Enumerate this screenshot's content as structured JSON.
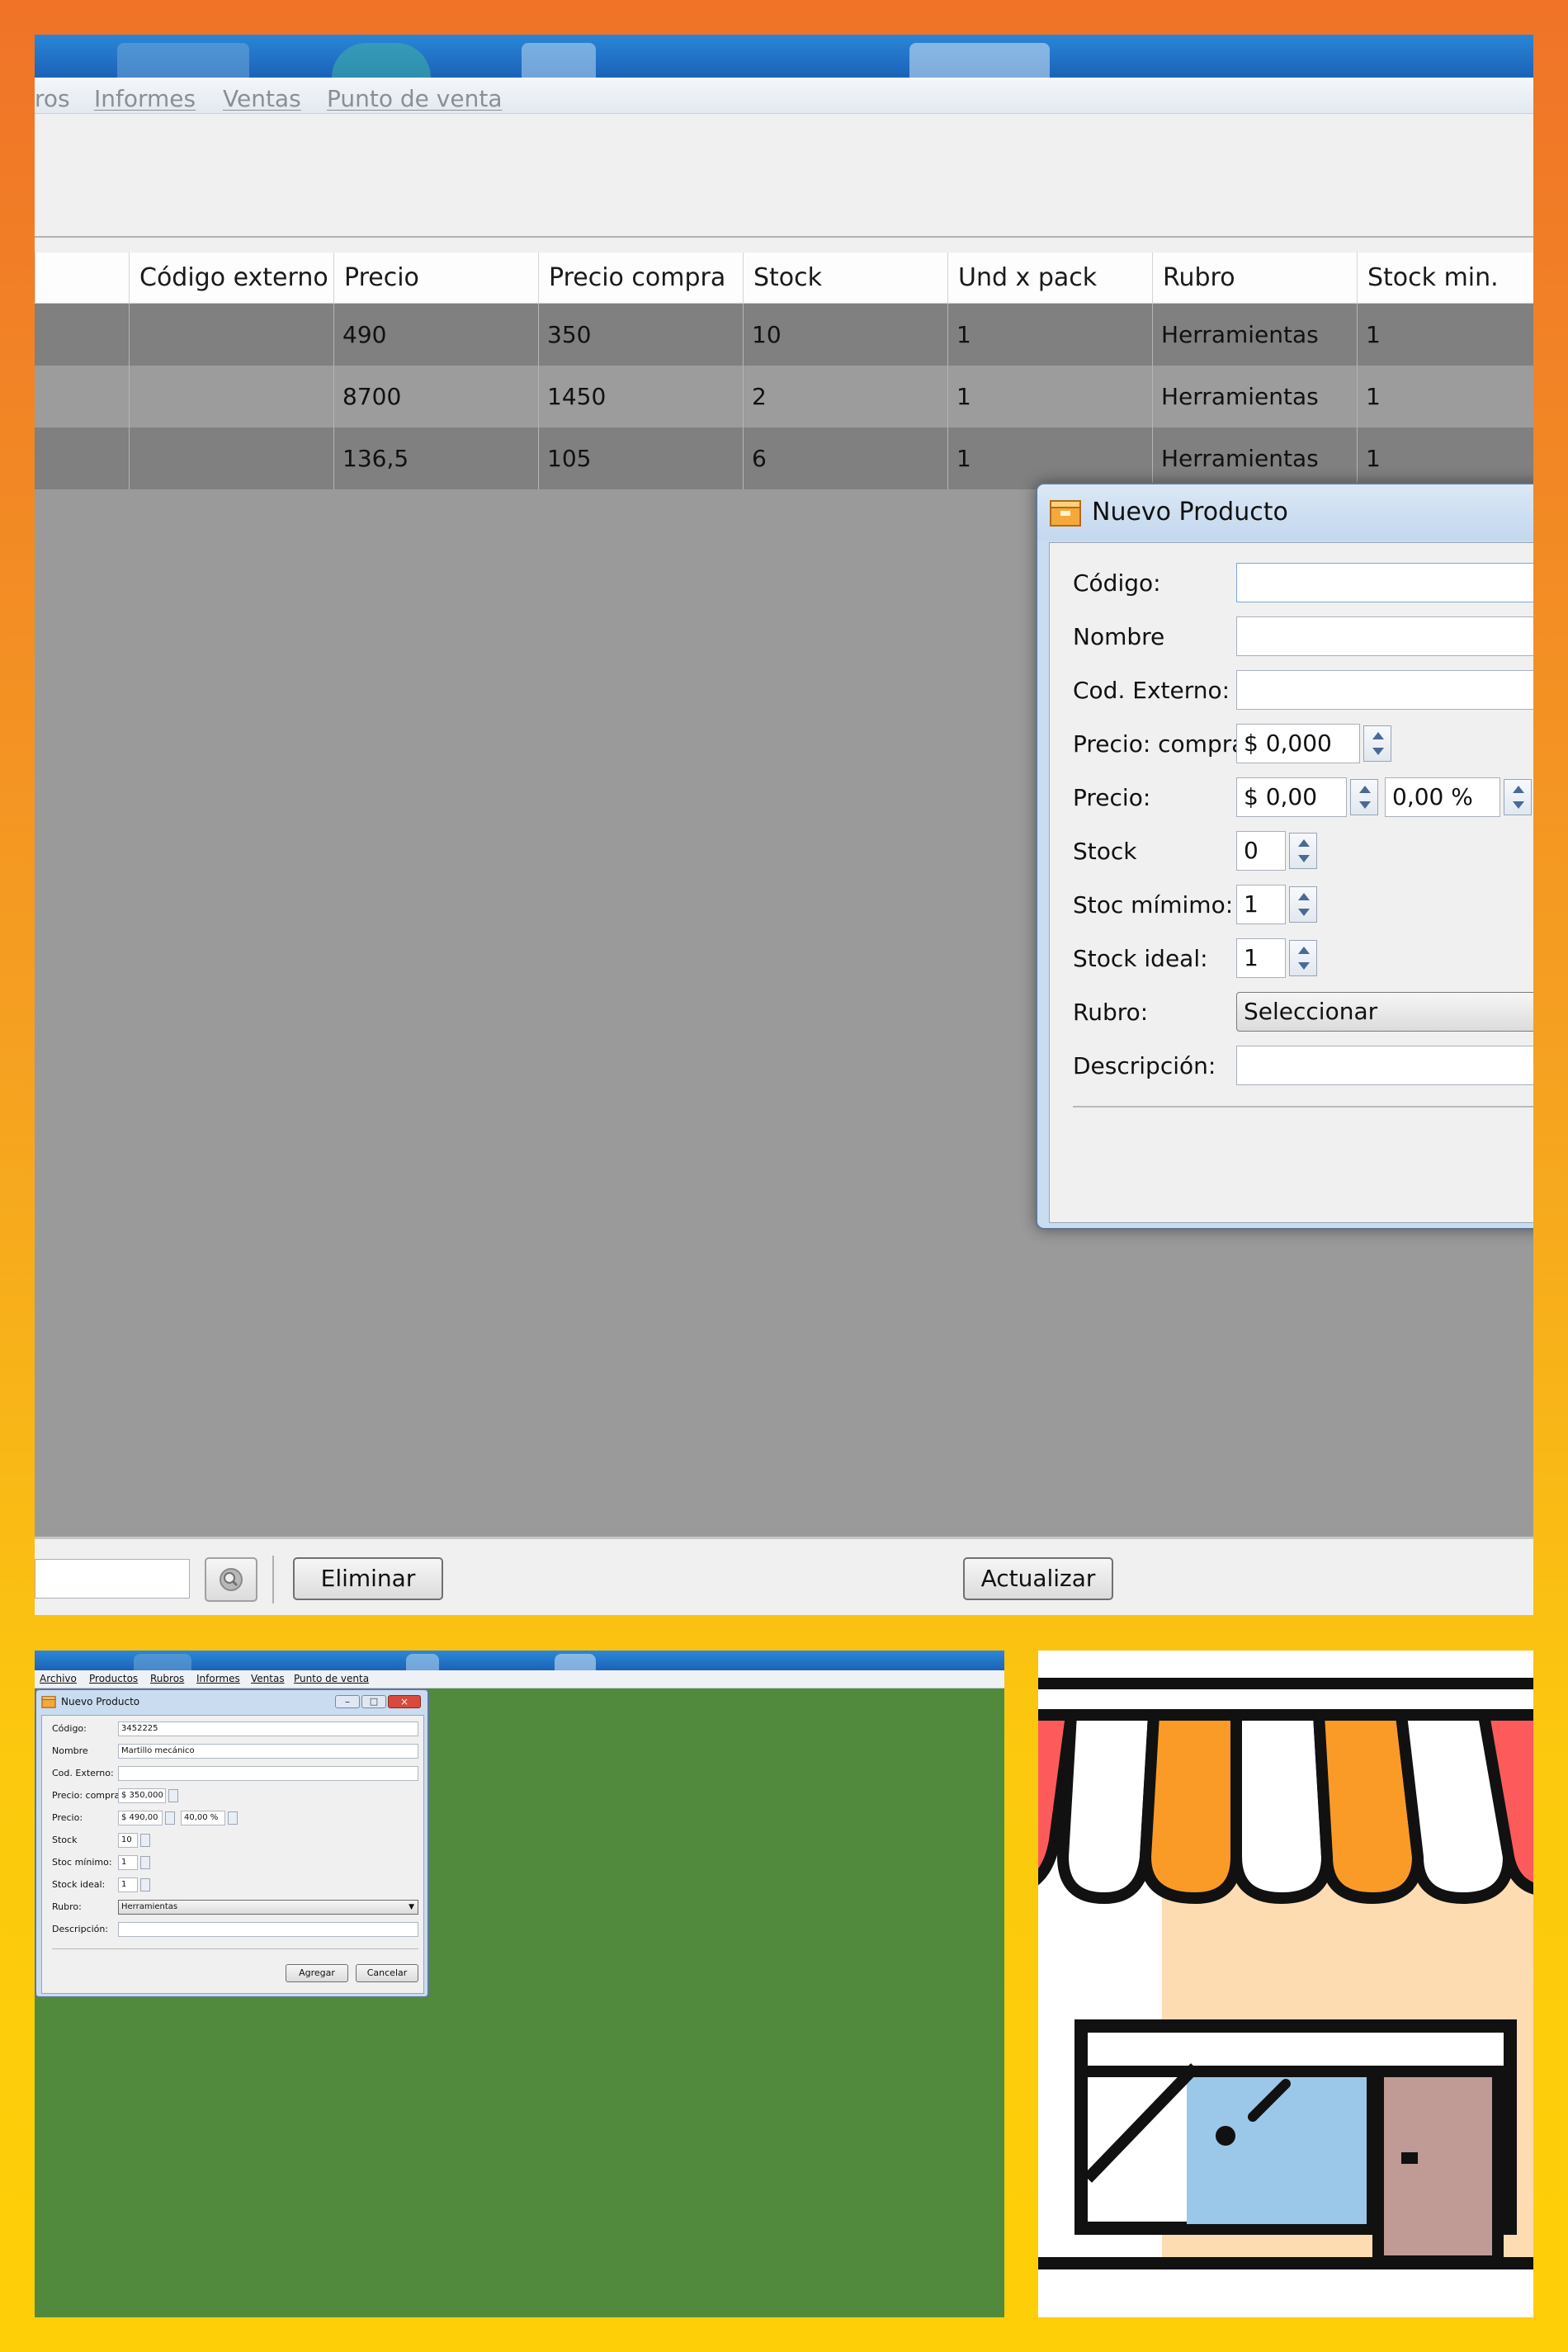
{
  "main_window": {
    "menu": [
      "ros",
      "Informes",
      "Ventas",
      "Punto de venta"
    ],
    "table": {
      "columns": [
        "Código externo",
        "Precio",
        "Precio compra",
        "Stock",
        "Und x pack",
        "Rubro",
        "Stock min."
      ],
      "rows": [
        [
          "",
          "490",
          "350",
          "10",
          "1",
          "Herramientas",
          "1"
        ],
        [
          "",
          "8700",
          "1450",
          "2",
          "1",
          "Herramientas",
          "1"
        ],
        [
          "",
          "136,5",
          "105",
          "6",
          "1",
          "Herramientas",
          "1"
        ]
      ]
    },
    "buttons": {
      "delete": "Eliminar",
      "refresh": "Actualizar"
    },
    "search_icon": "magnifier-icon",
    "dialog": {
      "title": "Nuevo Producto",
      "labels": {
        "codigo": "Código:",
        "nombre": "Nombre",
        "cod_externo": "Cod. Externo:",
        "precio_compra": "Precio: compra",
        "precio": "Precio:",
        "stock": "Stock",
        "stoc_minimo": "Stoc mímimo:",
        "stock_ideal": "Stock ideal:",
        "rubro": "Rubro:",
        "descripcion": "Descripción:"
      },
      "values": {
        "codigo": "",
        "nombre": "",
        "cod_externo": "",
        "precio_compra": "$ 0,000",
        "precio": "$ 0,00",
        "margen": "0,00 %",
        "stock": "0",
        "stoc_minimo": "1",
        "stock_ideal": "1",
        "rubro": "Seleccionar",
        "descripcion": ""
      }
    }
  },
  "secondary_window": {
    "menu": [
      "Archivo",
      "Productos",
      "Rubros",
      "Informes",
      "Ventas",
      "Punto de venta"
    ],
    "dialog": {
      "title": "Nuevo Producto",
      "labels": {
        "codigo": "Código:",
        "nombre": "Nombre",
        "cod_externo": "Cod. Externo:",
        "precio_compra": "Precio: compra",
        "precio": "Precio:",
        "stock": "Stock",
        "stoc_minimo": "Stoc mínimo:",
        "stock_ideal": "Stock ideal:",
        "rubro": "Rubro:",
        "descripcion": "Descripción:"
      },
      "values": {
        "codigo": "3452225",
        "nombre": "Martillo mecánico",
        "cod_externo": "",
        "precio_compra": "$ 350,000",
        "precio": "$ 490,00",
        "margen": "40,00 %",
        "stock": "10",
        "stoc_minimo": "1",
        "stock_ideal": "1",
        "rubro": "Herramientas",
        "descripcion": ""
      },
      "buttons": {
        "add": "Agregar",
        "cancel": "Cancelar"
      }
    }
  },
  "colors": {
    "background_gradient": [
      "#f07328",
      "#fecf07"
    ],
    "desktop_green": "#518a3c",
    "awning_red": "#fd5b5b",
    "awning_orange": "#fb9b27",
    "wall_peach": "#fddcb2",
    "glass_blue": "#9bc8e8",
    "door_brown": "#c09a94"
  },
  "icons": {
    "store": "store-icon",
    "dialog_app": "box-icon"
  }
}
